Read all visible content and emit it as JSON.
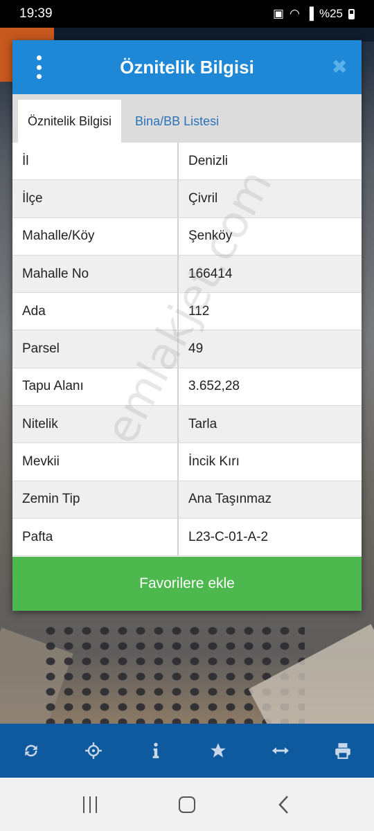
{
  "status_bar": {
    "time": "19:39",
    "battery_text": "%25"
  },
  "dialog": {
    "title": "Öznitelik Bilgisi",
    "tabs": [
      {
        "label": "Öznitelik Bilgisi",
        "active": true
      },
      {
        "label": "Bina/BB Listesi",
        "active": false
      }
    ],
    "rows": [
      {
        "key": "İl",
        "value": "Denizli"
      },
      {
        "key": "İlçe",
        "value": "Çivril"
      },
      {
        "key": "Mahalle/Köy",
        "value": "Şenköy"
      },
      {
        "key": "Mahalle No",
        "value": "166414"
      },
      {
        "key": "Ada",
        "value": "112"
      },
      {
        "key": "Parsel",
        "value": "49"
      },
      {
        "key": "Tapu Alanı",
        "value": "3.652,28"
      },
      {
        "key": "Nitelik",
        "value": "Tarla"
      },
      {
        "key": "Mevkii",
        "value": "İncik Kırı"
      },
      {
        "key": "Zemin Tip",
        "value": "Ana Taşınmaz"
      },
      {
        "key": "Pafta",
        "value": "L23-C-01-A-2"
      }
    ],
    "favorite_button": "Favorilere ekle"
  },
  "watermark": "emlakjet.com",
  "colors": {
    "header": "#1e88d6",
    "favorite": "#4cb84e",
    "toolbar": "#0f5a9e"
  },
  "toolbar": {
    "icons": [
      "refresh-icon",
      "locate-icon",
      "info-icon",
      "star-icon",
      "measure-icon",
      "print-icon"
    ]
  }
}
